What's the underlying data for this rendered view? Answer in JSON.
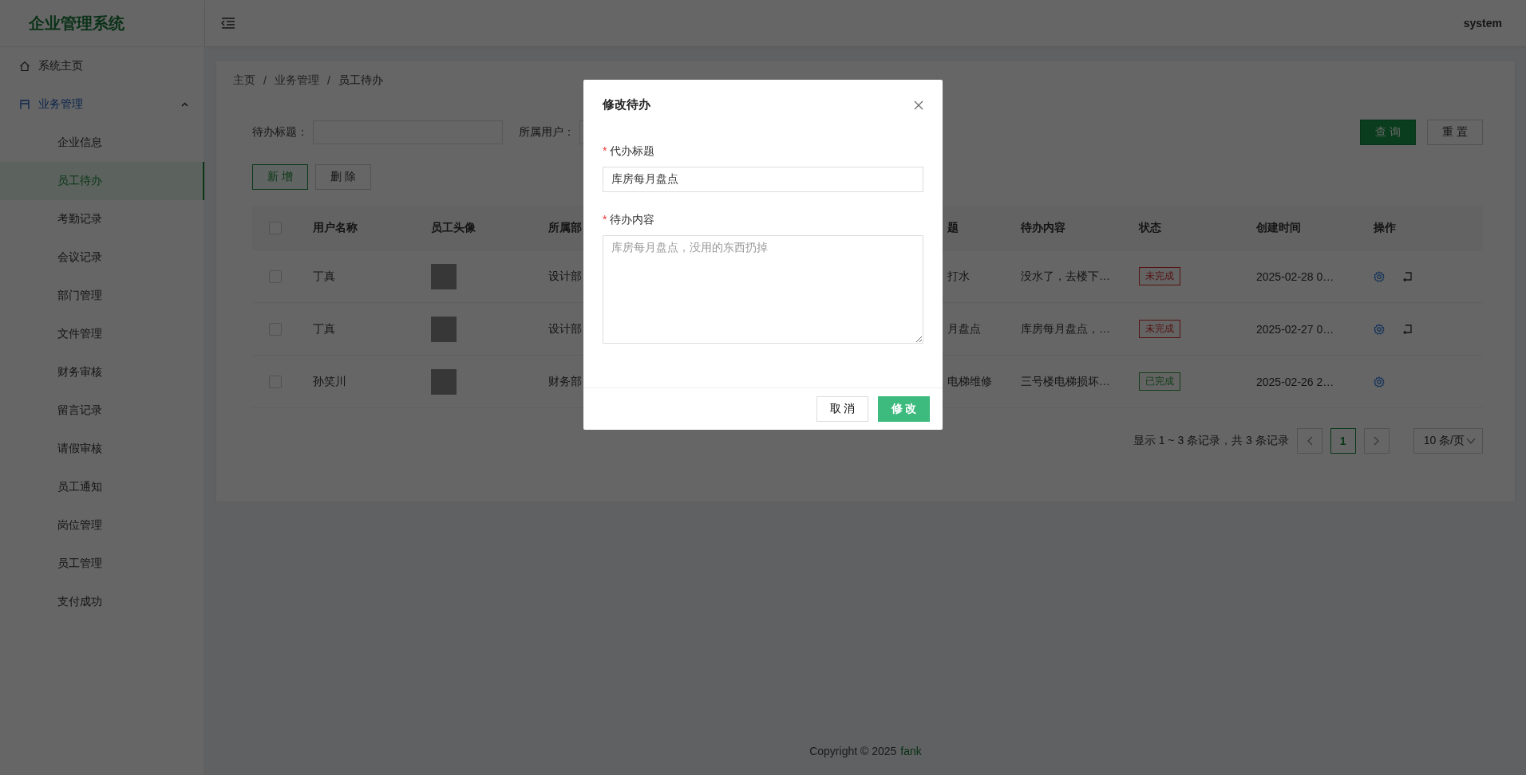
{
  "sidebar": {
    "title": "企业管理系统",
    "items": [
      {
        "kind": "link",
        "label": "系统主页",
        "selected": false
      },
      {
        "kind": "group",
        "label": "业务管理",
        "expanded": true,
        "children": [
          {
            "label": "企业信息",
            "selected": false
          },
          {
            "label": "员工待办",
            "selected": true
          },
          {
            "label": "考勤记录",
            "selected": false
          },
          {
            "label": "会议记录",
            "selected": false
          },
          {
            "label": "部门管理",
            "selected": false
          },
          {
            "label": "文件管理",
            "selected": false
          },
          {
            "label": "财务审核",
            "selected": false
          },
          {
            "label": "留言记录",
            "selected": false
          },
          {
            "label": "请假审核",
            "selected": false
          },
          {
            "label": "员工通知",
            "selected": false
          },
          {
            "label": "岗位管理",
            "selected": false
          },
          {
            "label": "员工管理",
            "selected": false
          },
          {
            "label": "支付成功",
            "selected": false
          }
        ]
      }
    ]
  },
  "header": {
    "user": "system"
  },
  "breadcrumb": {
    "separator": "/",
    "items": [
      "主页",
      "业务管理",
      "员工待办"
    ]
  },
  "filters": [
    {
      "label": "待办标题："
    },
    {
      "label": "所属用户："
    }
  ],
  "search_buttons": [
    {
      "label": "查 询",
      "kind": "primary"
    },
    {
      "label": "重 置",
      "kind": "default"
    }
  ],
  "toolbar": [
    {
      "label": "新 增",
      "kind": "add"
    },
    {
      "label": "删 除",
      "kind": "default"
    }
  ],
  "table": {
    "select_all": {
      "checked": false
    },
    "columns": [
      "用户名称",
      "员工头像",
      "所属部",
      "题",
      "待办内容",
      "状态",
      "创建时间",
      "操作"
    ],
    "rows": [
      {
        "checked": false,
        "name": "丁真",
        "dept": "设计部",
        "title": "打水",
        "content": "没水了，去楼下…",
        "status": "未完成",
        "color": "#561313",
        "created": "2025-02-28 0…",
        "actions": [
          {
            "kind": "edit"
          },
          {
            "kind": "revoke"
          }
        ]
      },
      {
        "checked": false,
        "name": "丁真",
        "dept": "设计部",
        "title": "月盘点",
        "content": "库房每月盘点，…",
        "status": "未完成",
        "color": "#561313",
        "created": "2025-02-27 0…",
        "actions": [
          {
            "kind": "edit"
          },
          {
            "kind": "revoke"
          }
        ]
      },
      {
        "checked": false,
        "name": "孙笑川",
        "dept": "财务部",
        "title": "电梯维修",
        "content": "三号楼电梯损坏…",
        "status": "已完成",
        "color": "#113e17",
        "created": "2025-02-26 2…",
        "actions": [
          {
            "kind": "edit"
          }
        ]
      }
    ]
  },
  "pagination": {
    "summary": "显示 1 ~ 3 条记录，共 3 条记录",
    "pages": [
      {
        "label": "1",
        "selected": true
      }
    ],
    "page_size": "10 条/页"
  },
  "footer": {
    "text": "Copyright © 2025",
    "author": "fank"
  },
  "dialog": {
    "title": "修改待办",
    "fields": [
      {
        "kind": "input",
        "label": "代办标题",
        "required_mark": "*",
        "value": "库房每月盘点"
      },
      {
        "kind": "textarea",
        "label": "待办内容",
        "required_mark": "*",
        "placeholder": "库房每月盘点，没用的东西扔掉"
      }
    ],
    "buttons": [
      {
        "label": "取 消",
        "kind": "default"
      },
      {
        "label": "修 改",
        "kind": "primary"
      }
    ]
  }
}
